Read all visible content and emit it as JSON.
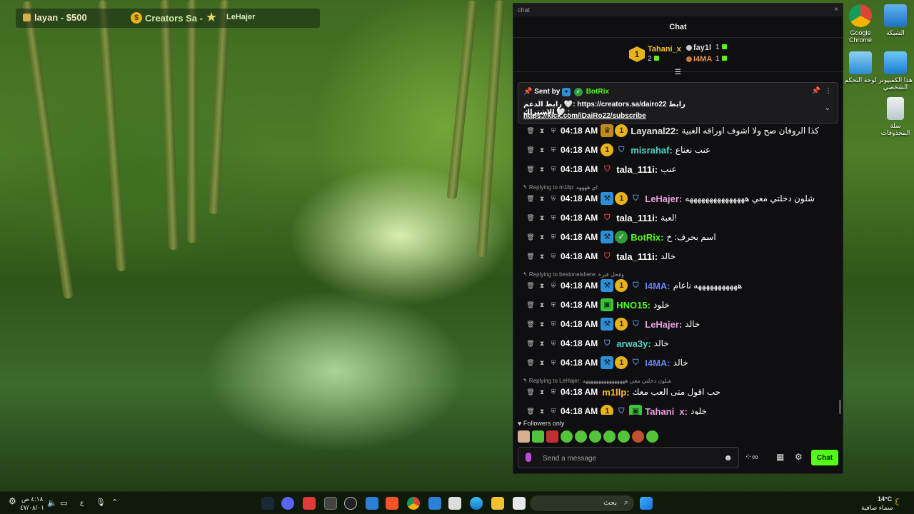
{
  "overlay": {
    "balance_label": "layan - $500",
    "ticker_label": "Creators Sa -",
    "ticker_user": "LeHajer"
  },
  "desktop": {
    "icons": [
      {
        "label": "Google Chrome",
        "icon": "chrome-icon"
      },
      {
        "label": "الشبكة",
        "icon": "network-icon"
      },
      {
        "label": "لوحة التحكم",
        "icon": "control-panel-icon"
      },
      {
        "label": "هذا الكمبيوتر الشخصي",
        "icon": "this-pc-icon"
      },
      {
        "label": "سلة المحذوفات",
        "icon": "recycle-bin-icon"
      }
    ]
  },
  "chat": {
    "window_title": "chat",
    "close": "×",
    "header": "Chat",
    "top_gifters": [
      {
        "rank": "1",
        "name": "Tahani_x",
        "count": "2"
      },
      {
        "name": "fay1l",
        "count": "1"
      },
      {
        "name": "I4MA",
        "count": "1"
      }
    ],
    "pinned": {
      "sent_by": "Sent by",
      "bot": "BotRix",
      "line1": "رابط الدعم 🤍: https://creators.sa/dairo22 رابط الاشتراك 🤍 :",
      "line2": "https://kick.com/iDaiRo22/subscribe"
    },
    "messages": [
      {
        "time": "04:18 AM",
        "user": "Layanal22",
        "color": "#e6e6e6",
        "text": "كذا الروفان صح ولا اشوف اوراقه الغبية",
        "badges": [
          "crown",
          "one"
        ]
      },
      {
        "time": "04:18 AM",
        "user": "misrahaf",
        "color": "#4fd4c8",
        "text": "عنب نعناع",
        "badges": [
          "one",
          "kick"
        ]
      },
      {
        "time": "04:18 AM",
        "user": "tala_111i",
        "color": "#ffffff",
        "text": "عنب",
        "badges": [
          "red"
        ]
      },
      {
        "time": "04:18 AM",
        "user": "LeHajer",
        "color": "#e8a0e0",
        "text": "شلون دخلتي معي هههههههههههههههه",
        "badges": [
          "mod",
          "one",
          "kick"
        ],
        "reply": "Replying to m1llp: اي ههههه"
      },
      {
        "time": "04:18 AM",
        "user": "tala_111i",
        "color": "#ffffff",
        "text": "لعبة!",
        "badges": [
          "red"
        ]
      },
      {
        "time": "04:18 AM",
        "user": "BotRix",
        "color": "#53fc18",
        "text": "اسم بحرف: خ",
        "badges": [
          "mod",
          "ver"
        ]
      },
      {
        "time": "04:18 AM",
        "user": "tala_111i",
        "color": "#ffffff",
        "text": "خالد",
        "badges": [
          "red"
        ]
      },
      {
        "time": "04:18 AM",
        "user": "I4MA",
        "color": "#6a7ff0",
        "text": "هههههههههههه ناعام",
        "badges": [
          "mod",
          "one",
          "kick"
        ],
        "reply": "Replying to bestoneishere: وفحل قيرة"
      },
      {
        "time": "04:18 AM",
        "user": "HNO15",
        "color": "#53fc18",
        "text": "خلود",
        "badges": [
          "green"
        ]
      },
      {
        "time": "04:18 AM",
        "user": "LeHajer",
        "color": "#e8a0e0",
        "text": "خالد",
        "badges": [
          "mod",
          "one",
          "kick"
        ]
      },
      {
        "time": "04:18 AM",
        "user": "arwa3y",
        "color": "#4fd4c8",
        "text": "خالد",
        "badges": [
          "kick"
        ]
      },
      {
        "time": "04:18 AM",
        "user": "I4MA",
        "color": "#6a7ff0",
        "text": "خالد",
        "badges": [
          "mod",
          "one",
          "kick"
        ]
      },
      {
        "time": "04:18 AM",
        "user": "m1llp",
        "color": "#f2c230",
        "text": "حب اقول متى العب معك",
        "badges": [],
        "reply": "Replying to LeHajer: شلون دخلتي معي ههههههههههههههههه"
      },
      {
        "time": "04:18 AM",
        "user": "Tahani_x",
        "color": "#e8a0e0",
        "text": "خلود",
        "badges": [
          "one",
          "kick",
          "green"
        ]
      }
    ],
    "followers_only": "Followers only",
    "input_placeholder": "Send a message",
    "send_label": "Chat"
  },
  "taskbar": {
    "search_placeholder": "بحث",
    "weather_temp": "14°C",
    "weather_desc": "سماء صافية",
    "time": "٤:١٨ ص",
    "date": "٤٧/٠٨/٠١",
    "lang": "ع"
  }
}
